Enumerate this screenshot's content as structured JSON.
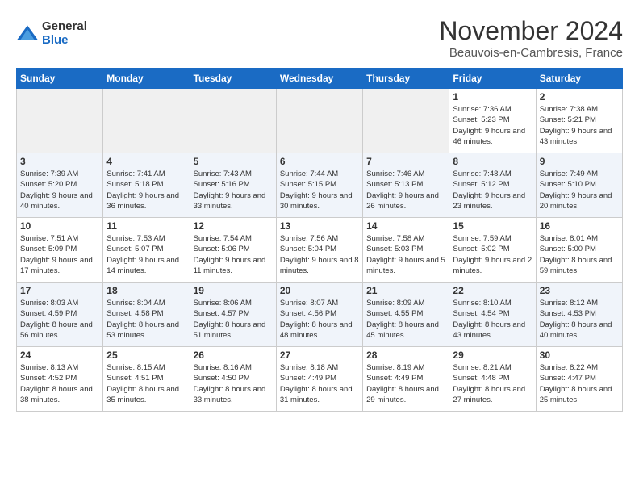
{
  "header": {
    "logo_general": "General",
    "logo_blue": "Blue",
    "month": "November 2024",
    "location": "Beauvois-en-Cambresis, France"
  },
  "weekdays": [
    "Sunday",
    "Monday",
    "Tuesday",
    "Wednesday",
    "Thursday",
    "Friday",
    "Saturday"
  ],
  "weeks": [
    [
      {
        "day": "",
        "empty": true
      },
      {
        "day": "",
        "empty": true
      },
      {
        "day": "",
        "empty": true
      },
      {
        "day": "",
        "empty": true
      },
      {
        "day": "",
        "empty": true
      },
      {
        "day": "1",
        "sunrise": "Sunrise: 7:36 AM",
        "sunset": "Sunset: 5:23 PM",
        "daylight": "Daylight: 9 hours and 46 minutes."
      },
      {
        "day": "2",
        "sunrise": "Sunrise: 7:38 AM",
        "sunset": "Sunset: 5:21 PM",
        "daylight": "Daylight: 9 hours and 43 minutes."
      }
    ],
    [
      {
        "day": "3",
        "sunrise": "Sunrise: 7:39 AM",
        "sunset": "Sunset: 5:20 PM",
        "daylight": "Daylight: 9 hours and 40 minutes."
      },
      {
        "day": "4",
        "sunrise": "Sunrise: 7:41 AM",
        "sunset": "Sunset: 5:18 PM",
        "daylight": "Daylight: 9 hours and 36 minutes."
      },
      {
        "day": "5",
        "sunrise": "Sunrise: 7:43 AM",
        "sunset": "Sunset: 5:16 PM",
        "daylight": "Daylight: 9 hours and 33 minutes."
      },
      {
        "day": "6",
        "sunrise": "Sunrise: 7:44 AM",
        "sunset": "Sunset: 5:15 PM",
        "daylight": "Daylight: 9 hours and 30 minutes."
      },
      {
        "day": "7",
        "sunrise": "Sunrise: 7:46 AM",
        "sunset": "Sunset: 5:13 PM",
        "daylight": "Daylight: 9 hours and 26 minutes."
      },
      {
        "day": "8",
        "sunrise": "Sunrise: 7:48 AM",
        "sunset": "Sunset: 5:12 PM",
        "daylight": "Daylight: 9 hours and 23 minutes."
      },
      {
        "day": "9",
        "sunrise": "Sunrise: 7:49 AM",
        "sunset": "Sunset: 5:10 PM",
        "daylight": "Daylight: 9 hours and 20 minutes."
      }
    ],
    [
      {
        "day": "10",
        "sunrise": "Sunrise: 7:51 AM",
        "sunset": "Sunset: 5:09 PM",
        "daylight": "Daylight: 9 hours and 17 minutes."
      },
      {
        "day": "11",
        "sunrise": "Sunrise: 7:53 AM",
        "sunset": "Sunset: 5:07 PM",
        "daylight": "Daylight: 9 hours and 14 minutes."
      },
      {
        "day": "12",
        "sunrise": "Sunrise: 7:54 AM",
        "sunset": "Sunset: 5:06 PM",
        "daylight": "Daylight: 9 hours and 11 minutes."
      },
      {
        "day": "13",
        "sunrise": "Sunrise: 7:56 AM",
        "sunset": "Sunset: 5:04 PM",
        "daylight": "Daylight: 9 hours and 8 minutes."
      },
      {
        "day": "14",
        "sunrise": "Sunrise: 7:58 AM",
        "sunset": "Sunset: 5:03 PM",
        "daylight": "Daylight: 9 hours and 5 minutes."
      },
      {
        "day": "15",
        "sunrise": "Sunrise: 7:59 AM",
        "sunset": "Sunset: 5:02 PM",
        "daylight": "Daylight: 9 hours and 2 minutes."
      },
      {
        "day": "16",
        "sunrise": "Sunrise: 8:01 AM",
        "sunset": "Sunset: 5:00 PM",
        "daylight": "Daylight: 8 hours and 59 minutes."
      }
    ],
    [
      {
        "day": "17",
        "sunrise": "Sunrise: 8:03 AM",
        "sunset": "Sunset: 4:59 PM",
        "daylight": "Daylight: 8 hours and 56 minutes."
      },
      {
        "day": "18",
        "sunrise": "Sunrise: 8:04 AM",
        "sunset": "Sunset: 4:58 PM",
        "daylight": "Daylight: 8 hours and 53 minutes."
      },
      {
        "day": "19",
        "sunrise": "Sunrise: 8:06 AM",
        "sunset": "Sunset: 4:57 PM",
        "daylight": "Daylight: 8 hours and 51 minutes."
      },
      {
        "day": "20",
        "sunrise": "Sunrise: 8:07 AM",
        "sunset": "Sunset: 4:56 PM",
        "daylight": "Daylight: 8 hours and 48 minutes."
      },
      {
        "day": "21",
        "sunrise": "Sunrise: 8:09 AM",
        "sunset": "Sunset: 4:55 PM",
        "daylight": "Daylight: 8 hours and 45 minutes."
      },
      {
        "day": "22",
        "sunrise": "Sunrise: 8:10 AM",
        "sunset": "Sunset: 4:54 PM",
        "daylight": "Daylight: 8 hours and 43 minutes."
      },
      {
        "day": "23",
        "sunrise": "Sunrise: 8:12 AM",
        "sunset": "Sunset: 4:53 PM",
        "daylight": "Daylight: 8 hours and 40 minutes."
      }
    ],
    [
      {
        "day": "24",
        "sunrise": "Sunrise: 8:13 AM",
        "sunset": "Sunset: 4:52 PM",
        "daylight": "Daylight: 8 hours and 38 minutes."
      },
      {
        "day": "25",
        "sunrise": "Sunrise: 8:15 AM",
        "sunset": "Sunset: 4:51 PM",
        "daylight": "Daylight: 8 hours and 35 minutes."
      },
      {
        "day": "26",
        "sunrise": "Sunrise: 8:16 AM",
        "sunset": "Sunset: 4:50 PM",
        "daylight": "Daylight: 8 hours and 33 minutes."
      },
      {
        "day": "27",
        "sunrise": "Sunrise: 8:18 AM",
        "sunset": "Sunset: 4:49 PM",
        "daylight": "Daylight: 8 hours and 31 minutes."
      },
      {
        "day": "28",
        "sunrise": "Sunrise: 8:19 AM",
        "sunset": "Sunset: 4:49 PM",
        "daylight": "Daylight: 8 hours and 29 minutes."
      },
      {
        "day": "29",
        "sunrise": "Sunrise: 8:21 AM",
        "sunset": "Sunset: 4:48 PM",
        "daylight": "Daylight: 8 hours and 27 minutes."
      },
      {
        "day": "30",
        "sunrise": "Sunrise: 8:22 AM",
        "sunset": "Sunset: 4:47 PM",
        "daylight": "Daylight: 8 hours and 25 minutes."
      }
    ]
  ]
}
